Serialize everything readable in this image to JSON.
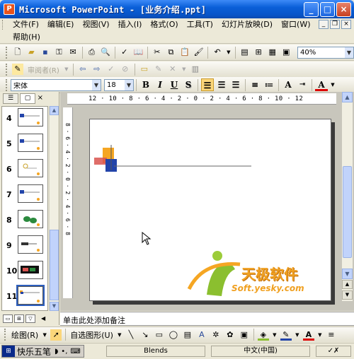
{
  "window": {
    "title": "Microsoft PowerPoint - [业务介绍.ppt]",
    "app_icon": "P"
  },
  "menu": {
    "row1": [
      "文件(F)",
      "编辑(E)",
      "视图(V)",
      "插入(I)",
      "格式(O)",
      "工具(T)",
      "幻灯片放映(D)",
      "窗口(W)"
    ],
    "row2": [
      "帮助(H)"
    ]
  },
  "standard_toolbar": {
    "zoom": "40%"
  },
  "reviewing_toolbar": {
    "reviewer_label": "审阅者(R)"
  },
  "formatting_toolbar": {
    "font": "宋体",
    "size": "18",
    "bold": "B",
    "italic": "I",
    "underline": "U",
    "shadow": "S",
    "grow_font": "A",
    "font_color": "A"
  },
  "slides_panel": {
    "tabs": [
      "outline-tab",
      "slides-tab"
    ],
    "close": "×",
    "slides": [
      {
        "number": "4"
      },
      {
        "number": "5"
      },
      {
        "number": "6"
      },
      {
        "number": "7"
      },
      {
        "number": "8"
      },
      {
        "number": "9"
      },
      {
        "number": "10"
      },
      {
        "number": "11",
        "selected": true
      }
    ]
  },
  "ruler": {
    "horizontal": "12 · 10 · 8 · 6 · 4 · 2 · 0 · 2 · 4 · 6 · 8 · 10 · 12",
    "vertical": "8 · 6 · 4 · 2 · 0 · 2 · 4 · 6 · 8"
  },
  "slide": {
    "watermark_title": "天极软件",
    "watermark_url": "Soft.yesky.com"
  },
  "notes": {
    "placeholder": "单击此处添加备注"
  },
  "drawing_toolbar": {
    "draw": "绘图(R)",
    "autoshapes": "自选图形(U)"
  },
  "status": {
    "ime_name": "快乐五笔",
    "design": "Blends",
    "language": "中文(中国)"
  },
  "colors": {
    "title_bar": "#0a5fd8",
    "accent_orange": "#f5a623",
    "accent_blue": "#2244aa",
    "accent_red": "#d9534f"
  }
}
